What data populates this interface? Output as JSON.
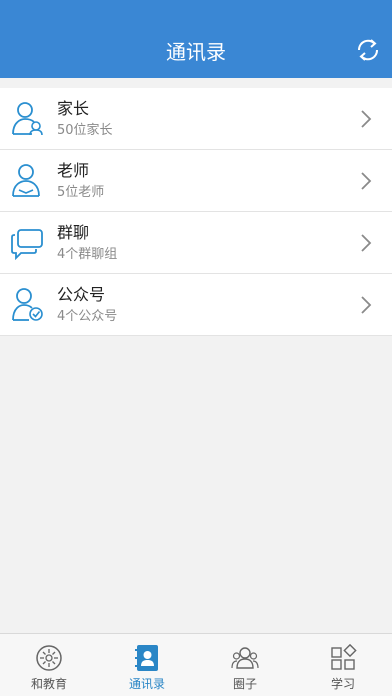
{
  "header": {
    "title": "通讯录",
    "refresh_icon": "refresh-icon"
  },
  "contacts": [
    {
      "name": "家长",
      "sub": "50位家长",
      "icon": "parent-user-icon"
    },
    {
      "name": "老师",
      "sub": "5位老师",
      "icon": "teacher-user-icon"
    },
    {
      "name": "群聊",
      "sub": "4个群聊组",
      "icon": "group-chat-icon"
    },
    {
      "name": "公众号",
      "sub": "4个公众号",
      "icon": "official-account-icon"
    }
  ],
  "tabs": [
    {
      "label": "和教育",
      "icon": "education-icon",
      "active": false
    },
    {
      "label": "通讯录",
      "icon": "contacts-book-icon",
      "active": true
    },
    {
      "label": "圈子",
      "icon": "circle-people-icon",
      "active": false
    },
    {
      "label": "学习",
      "icon": "study-blocks-icon",
      "active": false
    }
  ],
  "colors": {
    "header_bg": "#3a87d4",
    "accent": "#2a86c6",
    "icon_blue": "#2a8fd0"
  }
}
